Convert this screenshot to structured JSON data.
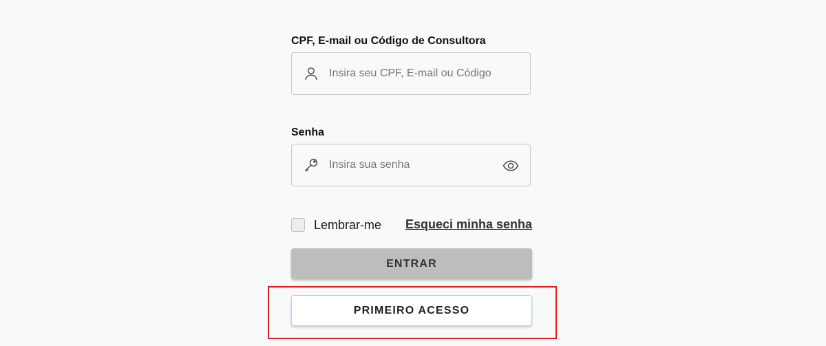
{
  "login_form": {
    "user_field": {
      "label": "CPF, E-mail ou Código de Consultora",
      "placeholder": "Insira seu CPF, E-mail ou Código",
      "value": "",
      "icon": "user-icon"
    },
    "password_field": {
      "label": "Senha",
      "placeholder": "Insira sua senha",
      "value": "",
      "icon": "key-icon",
      "toggle_icon": "eye-icon"
    },
    "remember_me": {
      "label": "Lembrar-me",
      "checked": false
    },
    "forgot_password_label": "Esqueci minha senha",
    "enter_button_label": "ENTRAR",
    "first_access_button_label": "PRIMEIRO ACESSO"
  },
  "colors": {
    "background": "#f8f9fa",
    "enter_button": "#bdbdbd",
    "first_access_border": "#f2c87a",
    "highlight_border": "#e02020"
  }
}
